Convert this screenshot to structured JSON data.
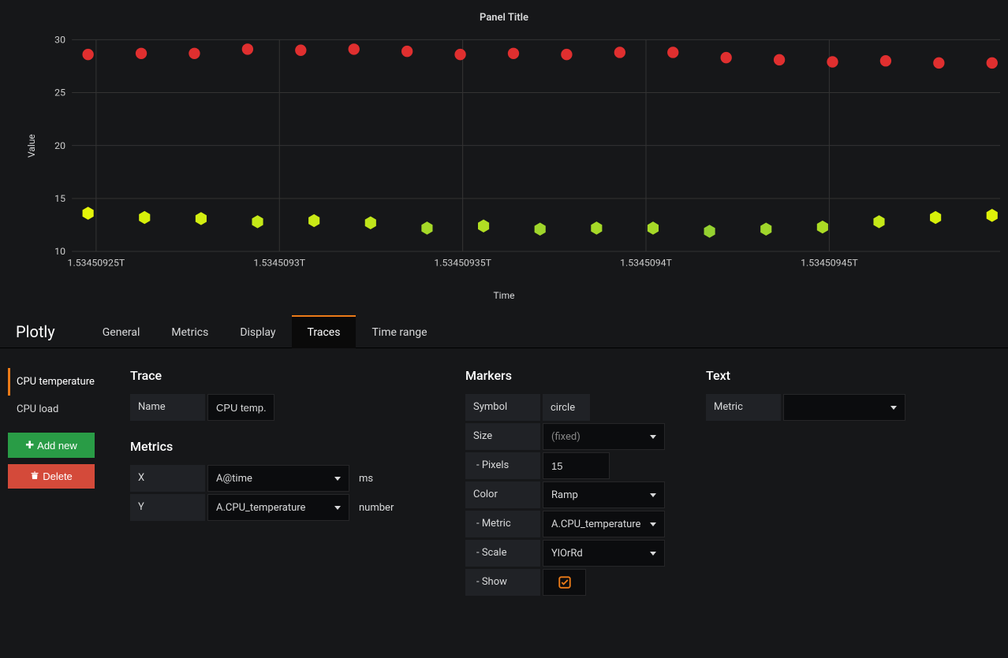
{
  "chart_data": {
    "type": "scatter",
    "title": "Panel Title",
    "xlabel": "Time",
    "ylabel": "Value",
    "ylim": [
      10,
      30
    ],
    "xticks": [
      "1.53450925T",
      "1.5345093T",
      "1.53450935T",
      "1.5345094T",
      "1.53450945T"
    ],
    "yticks": [
      10,
      15,
      20,
      25,
      30
    ],
    "series": [
      {
        "name": "CPU temperature",
        "marker": "circle",
        "color": "#e02f2f",
        "y": [
          28.6,
          28.7,
          28.7,
          29.1,
          29.0,
          29.1,
          28.9,
          28.6,
          28.7,
          28.6,
          28.8,
          28.8,
          28.3,
          28.1,
          27.9,
          28.0,
          27.8,
          27.8
        ]
      },
      {
        "name": "CPU load",
        "marker": "hexagon",
        "color_values": [
          13.6,
          13.2,
          13.1,
          12.8,
          12.9,
          12.7,
          12.2,
          12.4,
          12.1,
          12.2,
          12.2,
          11.9,
          12.1,
          12.3,
          12.8,
          13.2,
          13.4
        ],
        "colors": [
          "#e5f50a",
          "#d7f00a",
          "#d2ee11",
          "#c5e818",
          "#c9e916",
          "#c0e51b",
          "#a6d928",
          "#b1de23",
          "#a0d62b",
          "#a6d928",
          "#a6d928",
          "#95d130",
          "#a0d62b",
          "#abdb25",
          "#c5e818",
          "#d7f00a",
          "#dff20a"
        ],
        "y": [
          13.6,
          13.2,
          13.1,
          12.8,
          12.9,
          12.7,
          12.2,
          12.4,
          12.1,
          12.2,
          12.2,
          11.9,
          12.1,
          12.3,
          12.8,
          13.2,
          13.4
        ]
      }
    ]
  },
  "tabs": {
    "brand": "Plotly",
    "general": "General",
    "metrics": "Metrics",
    "display": "Display",
    "traces": "Traces",
    "time_range": "Time range"
  },
  "trace_list": {
    "items": [
      "CPU temperature",
      "CPU load"
    ],
    "add_label": "Add new",
    "delete_label": "Delete"
  },
  "trace_form": {
    "section": "Trace",
    "name_label": "Name",
    "name_value": "CPU temp...",
    "metrics_section": "Metrics",
    "x_label": "X",
    "x_value": "A@time",
    "x_unit": "ms",
    "y_label": "Y",
    "y_value": "A.CPU_temperature",
    "y_unit": "number"
  },
  "markers_form": {
    "section": "Markers",
    "symbol_label": "Symbol",
    "symbol_value": "circle",
    "size_label": "Size",
    "size_value": "(fixed)",
    "pixels_label": "- Pixels",
    "pixels_value": "15",
    "color_label": "Color",
    "color_value": "Ramp",
    "metric_label": "- Metric",
    "metric_value": "A.CPU_temperature",
    "scale_label": "- Scale",
    "scale_value": "YlOrRd",
    "show_label": "- Show"
  },
  "text_form": {
    "section": "Text",
    "metric_label": "Metric",
    "metric_value": ""
  }
}
